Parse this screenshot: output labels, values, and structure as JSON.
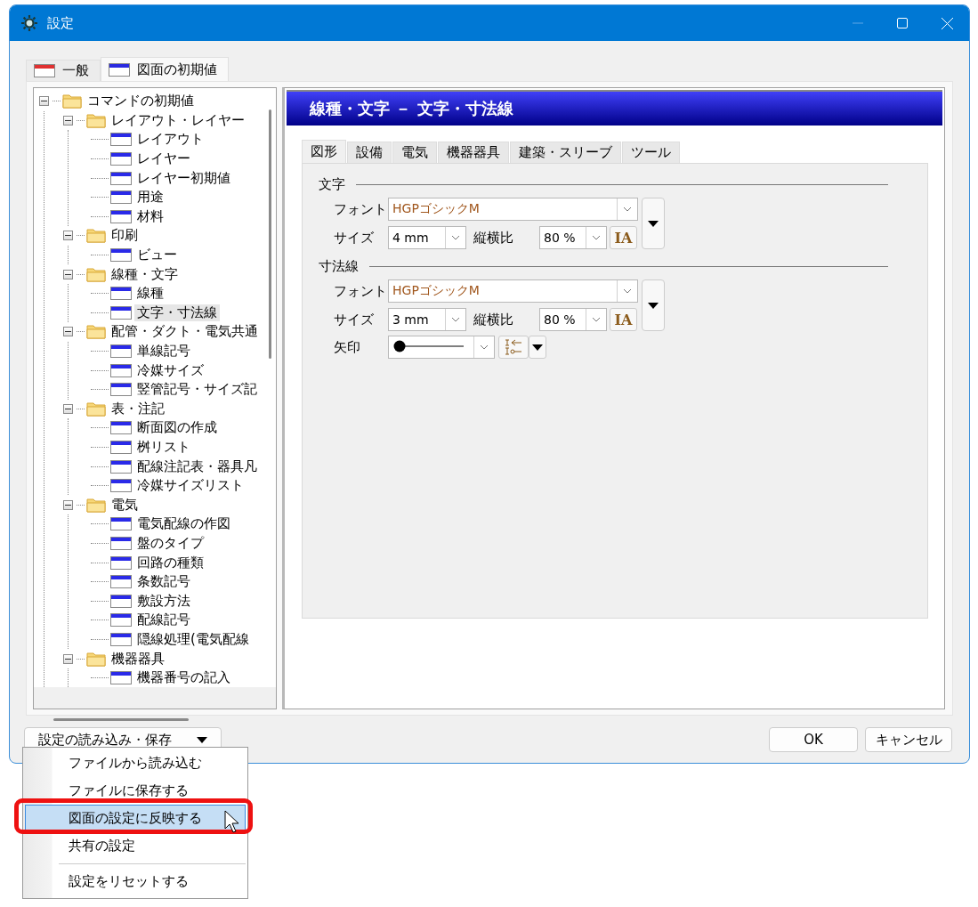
{
  "window": {
    "title": "設定"
  },
  "main_tabs": [
    {
      "label": "一般",
      "selected": false,
      "color": "#e03030"
    },
    {
      "label": "図面の初期値",
      "selected": true,
      "color": "#2a2ae0"
    }
  ],
  "tree": {
    "items": [
      {
        "label": "コマンドの初期値",
        "kind": "folder",
        "expanded": true,
        "selected": false,
        "children": [
          {
            "label": "レイアウト・レイヤー",
            "kind": "folder",
            "expanded": true,
            "selected": false,
            "children": [
              {
                "label": "レイアウト",
                "kind": "page",
                "selected": false
              },
              {
                "label": "レイヤー",
                "kind": "page",
                "selected": false
              },
              {
                "label": "レイヤー初期値",
                "kind": "page",
                "selected": false
              },
              {
                "label": "用途",
                "kind": "page",
                "selected": false
              },
              {
                "label": "材料",
                "kind": "page",
                "selected": false
              }
            ]
          },
          {
            "label": "印刷",
            "kind": "folder",
            "expanded": true,
            "selected": false,
            "children": [
              {
                "label": "ビュー",
                "kind": "page",
                "selected": false
              }
            ]
          },
          {
            "label": "線種・文字",
            "kind": "folder",
            "expanded": true,
            "selected": false,
            "children": [
              {
                "label": "線種",
                "kind": "page",
                "selected": false
              },
              {
                "label": "文字・寸法線",
                "kind": "page",
                "selected": true
              }
            ]
          },
          {
            "label": "配管・ダクト・電気共通",
            "kind": "folder",
            "expanded": true,
            "selected": false,
            "children": [
              {
                "label": "単線記号",
                "kind": "page",
                "selected": false
              },
              {
                "label": "冷媒サイズ",
                "kind": "page",
                "selected": false
              },
              {
                "label": "竪管記号・サイズ記",
                "kind": "page",
                "selected": false
              }
            ]
          },
          {
            "label": "表・注記",
            "kind": "folder",
            "expanded": true,
            "selected": false,
            "children": [
              {
                "label": "断面図の作成",
                "kind": "page",
                "selected": false
              },
              {
                "label": "桝リスト",
                "kind": "page",
                "selected": false
              },
              {
                "label": "配線注記表・器具凡",
                "kind": "page",
                "selected": false
              },
              {
                "label": "冷媒サイズリスト",
                "kind": "page",
                "selected": false
              }
            ]
          },
          {
            "label": "電気",
            "kind": "folder",
            "expanded": true,
            "selected": false,
            "children": [
              {
                "label": "電気配線の作図",
                "kind": "page",
                "selected": false
              },
              {
                "label": "盤のタイプ",
                "kind": "page",
                "selected": false
              },
              {
                "label": "回路の種類",
                "kind": "page",
                "selected": false
              },
              {
                "label": "条数記号",
                "kind": "page",
                "selected": false
              },
              {
                "label": "敷設方法",
                "kind": "page",
                "selected": false
              },
              {
                "label": "配線記号",
                "kind": "page",
                "selected": false
              },
              {
                "label": "隠線処理(電気配線",
                "kind": "page",
                "selected": false
              }
            ]
          },
          {
            "label": "機器器具",
            "kind": "folder",
            "expanded": true,
            "selected": false,
            "children": [
              {
                "label": "機器番号の記入",
                "kind": "page",
                "selected": false
              }
            ]
          }
        ]
      }
    ]
  },
  "panel": {
    "title": "線種・文字 － 文字・寸法線",
    "tabs": [
      {
        "label": "図形",
        "selected": true
      },
      {
        "label": "設備",
        "selected": false
      },
      {
        "label": "電気",
        "selected": false
      },
      {
        "label": "機器器具",
        "selected": false
      },
      {
        "label": "建築・スリーブ",
        "selected": false
      },
      {
        "label": "ツール",
        "selected": false
      }
    ],
    "sections": [
      {
        "title": "文字",
        "font_label": "フォント",
        "font": "HGPゴシックM",
        "size_label": "サイズ",
        "size": "4 mm",
        "ratio_label": "縦横比",
        "ratio": "80 %",
        "aspect_button": "IA"
      },
      {
        "title": "寸法線",
        "font_label": "フォント",
        "font": "HGPゴシックM",
        "size_label": "サイズ",
        "size": "3 mm",
        "ratio_label": "縦横比",
        "ratio": "80 %",
        "aspect_button": "IA",
        "arrow_label": "矢印"
      }
    ]
  },
  "footer": {
    "load_save": "設定の読み込み・保存",
    "ok": "OK",
    "cancel": "キャンセル"
  },
  "menu": {
    "items": [
      {
        "kind": "item",
        "label": "ファイルから読み込む",
        "selected": false
      },
      {
        "kind": "item",
        "label": "ファイルに保存する",
        "selected": false
      },
      {
        "kind": "item",
        "label": "図面の設定に反映する",
        "selected": true
      },
      {
        "kind": "item",
        "label": "共有の設定",
        "selected": false
      },
      {
        "kind": "separator"
      },
      {
        "kind": "item",
        "label": "設定をリセットする",
        "selected": false
      }
    ]
  }
}
